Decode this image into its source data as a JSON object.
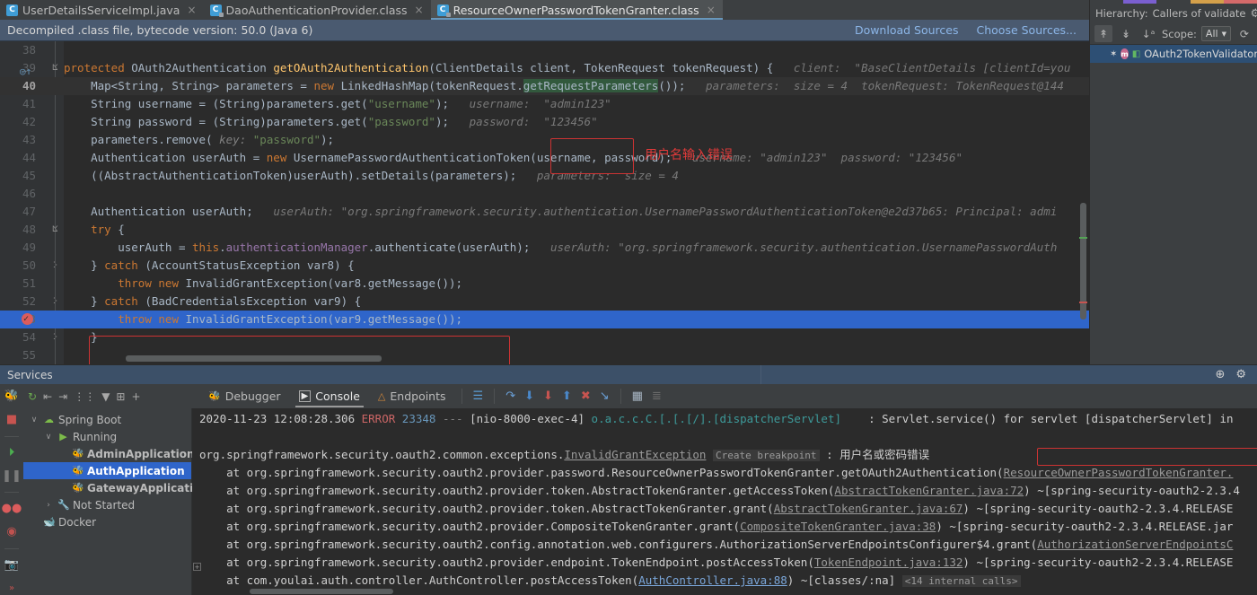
{
  "tabs": [
    {
      "label": "UserDetailsServiceImpl.java",
      "icon": "java-class-icon",
      "active": false,
      "close": "×"
    },
    {
      "label": "DaoAuthenticationProvider.class",
      "icon": "decompiled-class-icon",
      "active": false,
      "close": "×"
    },
    {
      "label": "ResourceOwnerPasswordTokenGranter.class",
      "icon": "decompiled-class-icon",
      "active": true,
      "close": "×"
    }
  ],
  "notification": {
    "message": "Decompiled .class file, bytecode version: 50.0 (Java 6)",
    "download_sources": "Download Sources",
    "choose_sources": "Choose Sources..."
  },
  "hierarchy": {
    "title_label": "Hierarchy:",
    "title_value": "Callers of validate",
    "gear": "⚙",
    "scope_label": "Scope:",
    "scope_value": "All",
    "chevron": "▼",
    "refresh": "⟳",
    "tree_icons": {
      "star": "✶",
      "method": "m",
      "lock": "◧"
    },
    "node": "OAuth2TokenValidator."
  },
  "editor": {
    "first_line": 38,
    "current_line": 40,
    "exec_line": 53,
    "breakpoint_line": 53,
    "annotation_values": "用户名输入错误",
    "lines": [
      {
        "n": 38,
        "html": ""
      },
      {
        "n": 39,
        "html": "<span class=\"kw\">protected</span> <span class=\"ident\">OAuth2Authentication</span> <span class=\"fn\">getOAuth2Authentication</span>(<span class=\"ident\">ClientDetails client</span>, <span class=\"ident\">TokenRequest tokenRequest</span>) {   <span class=\"inline-val\">client:  \"BaseClientDetails [clientId=you</span>",
        "fold": "ⴿ",
        "gutter": "run-to-cursor-icon"
      },
      {
        "n": 40,
        "html": "    <span class=\"ident\">Map&lt;String, String&gt; parameters</span> = <span class=\"kw\">new</span> <span class=\"ident\">LinkedHashMap</span>(<span class=\"ident\">tokenRequest</span>.<span class=\"srch\">getRequestParameters</span>());   <span class=\"inline-val\">parameters:  size = 4</span>  <span class=\"inline-val\">tokenRequest: TokenRequest@144</span>"
      },
      {
        "n": 41,
        "html": "    <span class=\"ident\">String username</span> = (<span class=\"ident\">String</span>)<span class=\"ident\">parameters</span>.<span class=\"ident\">get</span>(<span class=\"str\">\"username\"</span>);   <span class=\"inline-val\">username:</span>  <span class=\"inline-val\">\"admin123\"</span>"
      },
      {
        "n": 42,
        "html": "    <span class=\"ident\">String password</span> = (<span class=\"ident\">String</span>)<span class=\"ident\">parameters</span>.<span class=\"ident\">get</span>(<span class=\"str\">\"password\"</span>);   <span class=\"inline-val\">password:</span>  <span class=\"inline-val\">\"123456\"</span>"
      },
      {
        "n": 43,
        "html": "    <span class=\"ident\">parameters</span>.<span class=\"ident\">remove</span>( <span class=\"param-hint\">key:</span> <span class=\"str\">\"password\"</span>);"
      },
      {
        "n": 44,
        "html": "    <span class=\"ident\">Authentication userAuth</span> = <span class=\"kw\">new</span> <span class=\"ident\">UsernamePasswordAuthenticationToken</span>(<span class=\"ident\">username</span>, <span class=\"ident\">password</span>);   <span class=\"inline-val\">username: \"admin123\"</span>  <span class=\"inline-val\">password: \"123456\"</span>"
      },
      {
        "n": 45,
        "html": "    ((<span class=\"ident\">AbstractAuthenticationToken</span>)<span class=\"ident\">userAuth</span>).<span class=\"ident\">setDetails</span>(<span class=\"ident\">parameters</span>);   <span class=\"inline-val\">parameters:  size = 4</span>"
      },
      {
        "n": 46,
        "html": ""
      },
      {
        "n": 47,
        "html": "    <span class=\"ident\">Authentication userAuth</span>;   <span class=\"inline-val\">userAuth: \"org.springframework.security.authentication.UsernamePasswordAuthenticationToken@e2d37b65: Principal: admi</span>"
      },
      {
        "n": 48,
        "html": "    <span class=\"kw\">try</span> {",
        "fold": "ⴿ"
      },
      {
        "n": 49,
        "html": "        <span class=\"ident\">userAuth</span> = <span class=\"kw\">this</span>.<span class=\"fld\">authenticationManager</span>.<span class=\"ident\">authenticate</span>(<span class=\"ident\">userAuth</span>);   <span class=\"inline-val\">userAuth: \"org.springframework.security.authentication.UsernamePasswordAuth</span>"
      },
      {
        "n": 50,
        "html": "    } <span class=\"kw\">catch</span> (<span class=\"ident\">AccountStatusException var8</span>) {",
        "fold": "ⴾ"
      },
      {
        "n": 51,
        "html": "        <span class=\"kw\">throw</span> <span class=\"kw\">new</span> <span class=\"ident\">InvalidGrantException</span>(<span class=\"ident\">var8</span>.<span class=\"ident\">getMessage</span>());"
      },
      {
        "n": 52,
        "html": "    } <span class=\"kw\">catch</span> (<span class=\"ident\">BadCredentialsException var9</span>) {",
        "fold": "ⴾ"
      },
      {
        "n": 53,
        "html": "        <span class=\"kw\">throw</span> <span class=\"kw\">new</span> <span class=\"ident\">InvalidGrantException</span>(<span class=\"ident\">var9</span>.<span class=\"ident\">getMessage</span>());"
      },
      {
        "n": 54,
        "html": "    }",
        "fold": "ⴾ"
      },
      {
        "n": 55,
        "html": ""
      }
    ]
  },
  "services": {
    "panel_title": "Services",
    "header_icons": {
      "locate": "⊕",
      "settings": "⚙"
    },
    "toolbar_icons": [
      "rerun-icon",
      "expand-all-icon",
      "collapse-all-icon",
      "group-icon",
      "filter-icon",
      "add-frame-icon",
      "add-icon"
    ],
    "rail_icons": [
      "debug-icon",
      "stop-icon",
      "resume-icon",
      "pause-icon",
      "breakpoints-icon",
      "mute-breakpoints-icon",
      "screenshot-icon",
      "more-icon"
    ],
    "tree": [
      {
        "label": "Spring Boot",
        "depth": 0,
        "twisty": "∨",
        "icon": "spring-boot-icon",
        "selected": false,
        "bold": false
      },
      {
        "label": "Running",
        "depth": 1,
        "twisty": "∨",
        "icon": "running-icon",
        "selected": false,
        "bold": false
      },
      {
        "label": "AdminApplication",
        "depth": 2,
        "twisty": "",
        "icon": "spring-app-icon",
        "selected": false,
        "bold": true
      },
      {
        "label": "AuthApplication",
        "depth": 2,
        "twisty": "",
        "icon": "spring-app-icon",
        "selected": true,
        "bold": true
      },
      {
        "label": "GatewayApplication",
        "depth": 2,
        "twisty": "",
        "icon": "spring-app-icon",
        "selected": false,
        "bold": true
      },
      {
        "label": "Not Started",
        "depth": 1,
        "twisty": "›",
        "icon": "wrench-icon",
        "selected": false,
        "bold": false
      },
      {
        "label": "Docker",
        "depth": 0,
        "twisty": "",
        "icon": "docker-icon",
        "selected": false,
        "bold": false
      }
    ],
    "console_tabs": [
      {
        "label": "Debugger",
        "icon": "debugger-icon",
        "active": false
      },
      {
        "label": "Console",
        "icon": "console-icon",
        "active": true
      },
      {
        "label": "Endpoints",
        "icon": "endpoints-icon",
        "active": false
      }
    ],
    "console_toolbar_icons": [
      "soft-wrap-icon",
      "step-over-icon",
      "step-into-icon",
      "force-step-into-icon",
      "step-out-icon",
      "drop-frame-icon",
      "run-to-cursor-icon",
      "evaluate-icon",
      "layout-icon"
    ]
  },
  "console_output": [
    {
      "html": "<span class=\"c-cn\">2020-11-23 12:08:28.306</span> <span class=\"c-err\">ERROR</span> <span class=\"c-num\">23348</span> <span class=\"c-dim\">---</span> <span class=\"c-cn\">[nio-8000-exec-4]</span> <span class=\"c-teal\">o.a.c.c.C.[.[.[/].[dispatcherServlet]</span>    <span class=\"c-cn\">: Servlet.service() for servlet [dispatcherServlet] in</span>"
    },
    {
      "html": ""
    },
    {
      "html": "<span class=\"c-cn\">org.springframework.security.oauth2.common.exceptions.</span><span class=\"c-link-g\">InvalidGrantException</span> <span class=\"c-cb\">Create breakpoint</span> <span class=\"c-cn\">: 用户名或密码错误</span>"
    },
    {
      "html": "    <span class=\"c-cn\">at org.springframework.security.oauth2.provider.password.ResourceOwnerPasswordTokenGranter.getOAuth2Authentication(</span><span class=\"c-link-g\">ResourceOwnerPasswordTokenGranter.</span>"
    },
    {
      "html": "    <span class=\"c-cn\">at org.springframework.security.oauth2.provider.token.AbstractTokenGranter.getAccessToken(</span><span class=\"c-link-g\">AbstractTokenGranter.java:72</span><span class=\"c-cn\">) ~[spring-security-oauth2-2.3.4</span>"
    },
    {
      "html": "    <span class=\"c-cn\">at org.springframework.security.oauth2.provider.token.AbstractTokenGranter.grant(</span><span class=\"c-link-g\">AbstractTokenGranter.java:67</span><span class=\"c-cn\">) ~[spring-security-oauth2-2.3.4.RELEASE</span>"
    },
    {
      "html": "    <span class=\"c-cn\">at org.springframework.security.oauth2.provider.CompositeTokenGranter.grant(</span><span class=\"c-link-g\">CompositeTokenGranter.java:38</span><span class=\"c-cn\">) ~[spring-security-oauth2-2.3.4.RELEASE.jar</span>"
    },
    {
      "html": "    <span class=\"c-cn\">at org.springframework.security.oauth2.config.annotation.web.configurers.AuthorizationServerEndpointsConfigurer$4.grant(</span><span class=\"c-link-g\">AuthorizationServerEndpointsC</span>"
    },
    {
      "html": "    <span class=\"c-cn\">at org.springframework.security.oauth2.provider.endpoint.TokenEndpoint.postAccessToken(</span><span class=\"c-link-g\">TokenEndpoint.java:132</span><span class=\"c-cn\">) ~[spring-security-oauth2-2.3.4.RELEASE</span>"
    },
    {
      "html": "    <span class=\"c-cn\">at com.youlai.auth.controller.AuthController.postAccessToken(</span><span class=\"c-link\">AuthController.java:88</span><span class=\"c-cn\">) ~[classes/:na]</span> <span class=\"c-cb\">&lt;14 internal calls&gt;</span>"
    }
  ],
  "colors": {
    "accent_blue": "#2f65ca",
    "error_red": "#cc6666",
    "annotation_red": "#e03a3a",
    "editor_bg": "#2b2b2b",
    "panel_bg": "#3c3f41",
    "notif_bg": "#4a5a70"
  }
}
